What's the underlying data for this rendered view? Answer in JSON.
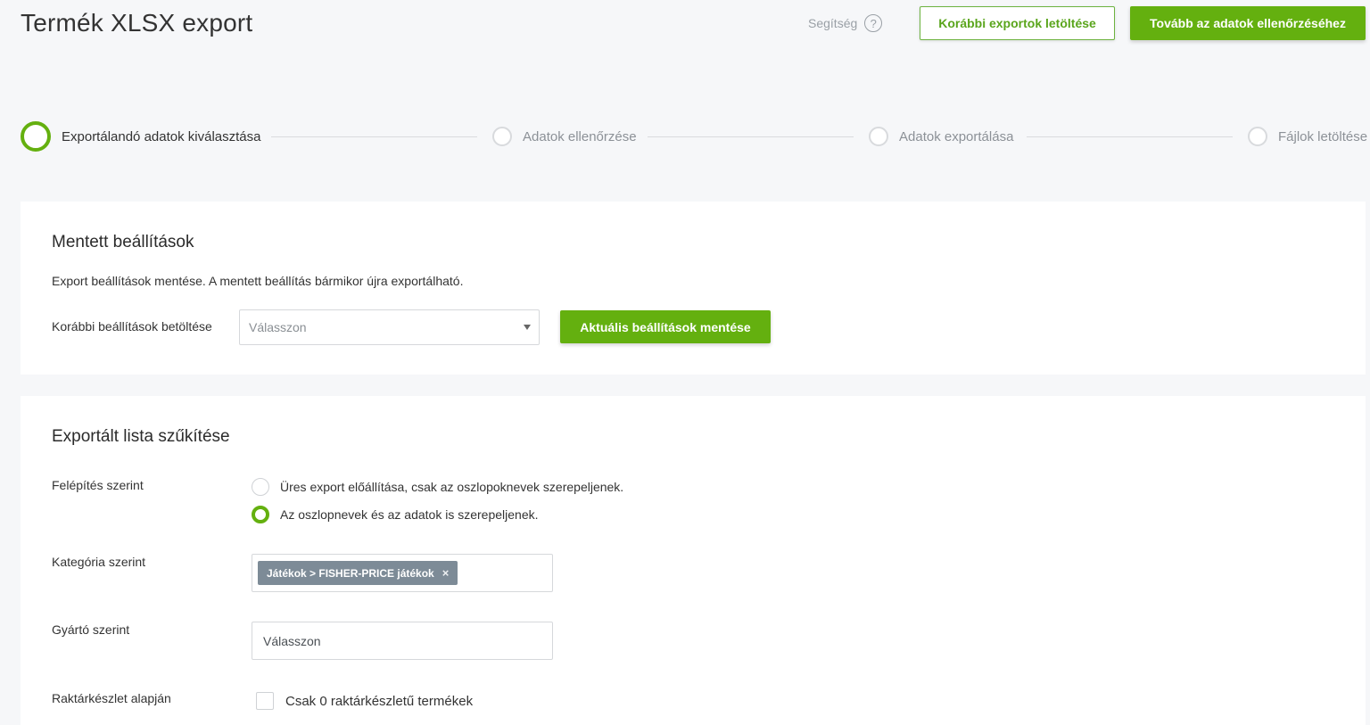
{
  "header": {
    "title": "Termék XLSX export",
    "help_label": "Segítség",
    "help_icon": "?",
    "previous_exports_button": "Korábbi exportok letöltése",
    "next_button": "Tovább az adatok ellenőrzéséhez"
  },
  "stepper": {
    "steps": [
      {
        "label": "Exportálandó adatok kiválasztása",
        "active": true
      },
      {
        "label": "Adatok ellenőrzése",
        "active": false
      },
      {
        "label": "Adatok exportálása",
        "active": false
      },
      {
        "label": "Fájlok letöltése",
        "active": false
      }
    ]
  },
  "saved_settings": {
    "title": "Mentett beállítások",
    "description": "Export beállítások mentése. A mentett beállítás bármikor újra exportálható.",
    "load_label": "Korábbi beállítások betöltése",
    "load_placeholder": "Válasszon",
    "save_button": "Aktuális beállítások mentése"
  },
  "filter": {
    "title": "Exportált lista szűkítése",
    "structure_label": "Felépítés szerint",
    "structure_options": [
      {
        "label": "Üres export előállítása, csak az oszlopoknevek szerepeljenek.",
        "checked": false
      },
      {
        "label": "Az oszlopnevek és az adatok is szerepeljenek.",
        "checked": true
      }
    ],
    "category_label": "Kategória szerint",
    "category_tag": "Játékok > FISHER-PRICE játékok",
    "category_tag_remove": "×",
    "manufacturer_label": "Gyártó szerint",
    "manufacturer_placeholder": "Válasszon",
    "stock_label": "Raktárkészlet alapján",
    "stock_checkbox_label": "Csak 0 raktárkészletű termékek"
  },
  "colors": {
    "accent": "#64b00f",
    "tag_bg": "#7d8b97"
  }
}
